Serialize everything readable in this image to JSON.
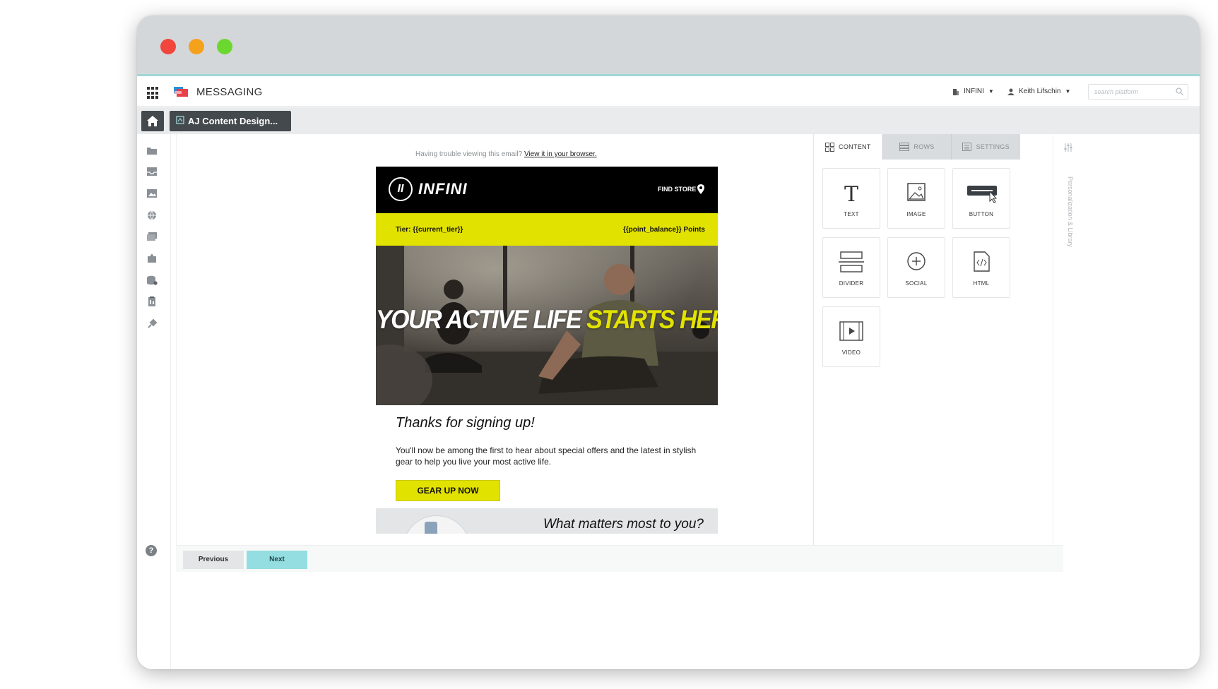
{
  "app": {
    "name": "MESSAGING"
  },
  "account": {
    "org": "INFINI",
    "user": "Keith Lifschin"
  },
  "search": {
    "placeholder": "search platform"
  },
  "tabs": {
    "document": "AJ Content Design..."
  },
  "email": {
    "trouble_text": "Having trouble viewing this email?",
    "browser_link": "View it in your browser.",
    "brand_mark": "II",
    "brand": "INFINI",
    "find_store": "FIND STORE",
    "tier": "Tier: {{current_tier}}",
    "points": "{{point_balance}} Points",
    "hero_line_1": "YOUR ACTIVE LIFE",
    "hero_line_2": "STARTS HERE",
    "thanks": "Thanks for signing up!",
    "body": "You'll now be among the first to hear about special offers and the latest in stylish gear to help you live your most active life.",
    "cta": "GEAR UP NOW",
    "next_heading": "What matters most to you?"
  },
  "panel": {
    "tabs": [
      {
        "label": "CONTENT",
        "active": true
      },
      {
        "label": "ROWS",
        "active": false
      },
      {
        "label": "SETTINGS",
        "active": false
      }
    ],
    "tiles": [
      {
        "label": "TEXT",
        "icon": "text-icon"
      },
      {
        "label": "IMAGE",
        "icon": "image-icon"
      },
      {
        "label": "BUTTON",
        "icon": "button-icon"
      },
      {
        "label": "DIVIDER",
        "icon": "divider-icon"
      },
      {
        "label": "SOCIAL",
        "icon": "social-icon"
      },
      {
        "label": "HTML",
        "icon": "html-icon"
      },
      {
        "label": "VIDEO",
        "icon": "video-icon"
      }
    ]
  },
  "side_label": "Personalization & Library",
  "footer": {
    "previous": "Previous",
    "next": "Next"
  },
  "help": "?",
  "colors": {
    "accent_yellow": "#e2e200",
    "next_button": "#94dde0",
    "dark_tab": "#44494e"
  }
}
